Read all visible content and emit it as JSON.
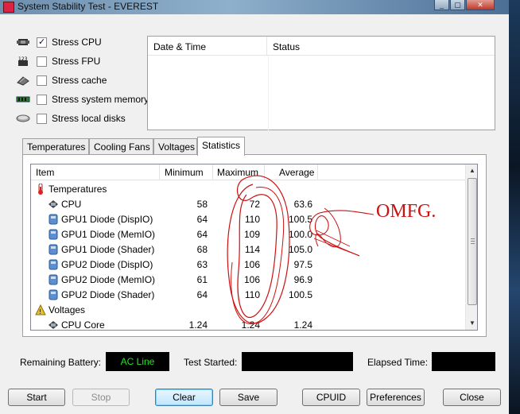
{
  "window": {
    "title": "System Stability Test - EVEREST",
    "controls": [
      "_",
      "▢",
      "✕"
    ]
  },
  "stress_options": [
    {
      "label": "Stress CPU",
      "checked": true,
      "icon": "cpu-icon"
    },
    {
      "label": "Stress FPU",
      "checked": false,
      "icon": "fpu-icon"
    },
    {
      "label": "Stress cache",
      "checked": false,
      "icon": "cache-icon"
    },
    {
      "label": "Stress system memory",
      "checked": false,
      "icon": "memory-icon"
    },
    {
      "label": "Stress local disks",
      "checked": false,
      "icon": "disk-icon"
    }
  ],
  "log": {
    "columns": [
      "Date & Time",
      "Status"
    ]
  },
  "tabs": [
    {
      "label": "Temperatures",
      "active": false
    },
    {
      "label": "Cooling Fans",
      "active": false
    },
    {
      "label": "Voltages",
      "active": false
    },
    {
      "label": "Statistics",
      "active": true
    }
  ],
  "stats": {
    "columns": [
      "Item",
      "Minimum",
      "Maximum",
      "Average"
    ],
    "groups": [
      {
        "label": "Temperatures",
        "icon": "thermometer-icon",
        "rows": [
          {
            "name": "CPU",
            "min": "58",
            "max": "72",
            "avg": "63.6",
            "icon": "cpu-chip-icon"
          },
          {
            "name": "GPU1 Diode (DispIO)",
            "min": "64",
            "max": "110",
            "avg": "100.5",
            "icon": "gpu-icon"
          },
          {
            "name": "GPU1 Diode (MemIO)",
            "min": "64",
            "max": "109",
            "avg": "100.0",
            "icon": "gpu-icon"
          },
          {
            "name": "GPU1 Diode (Shader)",
            "min": "68",
            "max": "114",
            "avg": "105.0",
            "icon": "gpu-icon"
          },
          {
            "name": "GPU2 Diode (DispIO)",
            "min": "63",
            "max": "106",
            "avg": "97.5",
            "icon": "gpu-icon"
          },
          {
            "name": "GPU2 Diode (MemIO)",
            "min": "61",
            "max": "106",
            "avg": "96.9",
            "icon": "gpu-icon"
          },
          {
            "name": "GPU2 Diode (Shader)",
            "min": "64",
            "max": "110",
            "avg": "100.5",
            "icon": "gpu-icon"
          }
        ]
      },
      {
        "label": "Voltages",
        "icon": "voltage-warning-icon",
        "rows": [
          {
            "name": "CPU Core",
            "min": "1.24",
            "max": "1.24",
            "avg": "1.24",
            "icon": "cpu-chip-icon"
          }
        ]
      }
    ]
  },
  "status": {
    "battery_label": "Remaining Battery:",
    "battery_value": "AC Line",
    "started_label": "Test Started:",
    "started_value": "",
    "elapsed_label": "Elapsed Time:",
    "elapsed_value": ""
  },
  "buttons": {
    "start": "Start",
    "stop": "Stop",
    "clear": "Clear",
    "save": "Save",
    "cpuid": "CPUID",
    "preferences": "Preferences",
    "close": "Close"
  },
  "annotation": {
    "text": "OMFG.",
    "color": "#cc1111"
  },
  "colors": {
    "status_text": "#27e027",
    "status_bg": "#000000"
  }
}
